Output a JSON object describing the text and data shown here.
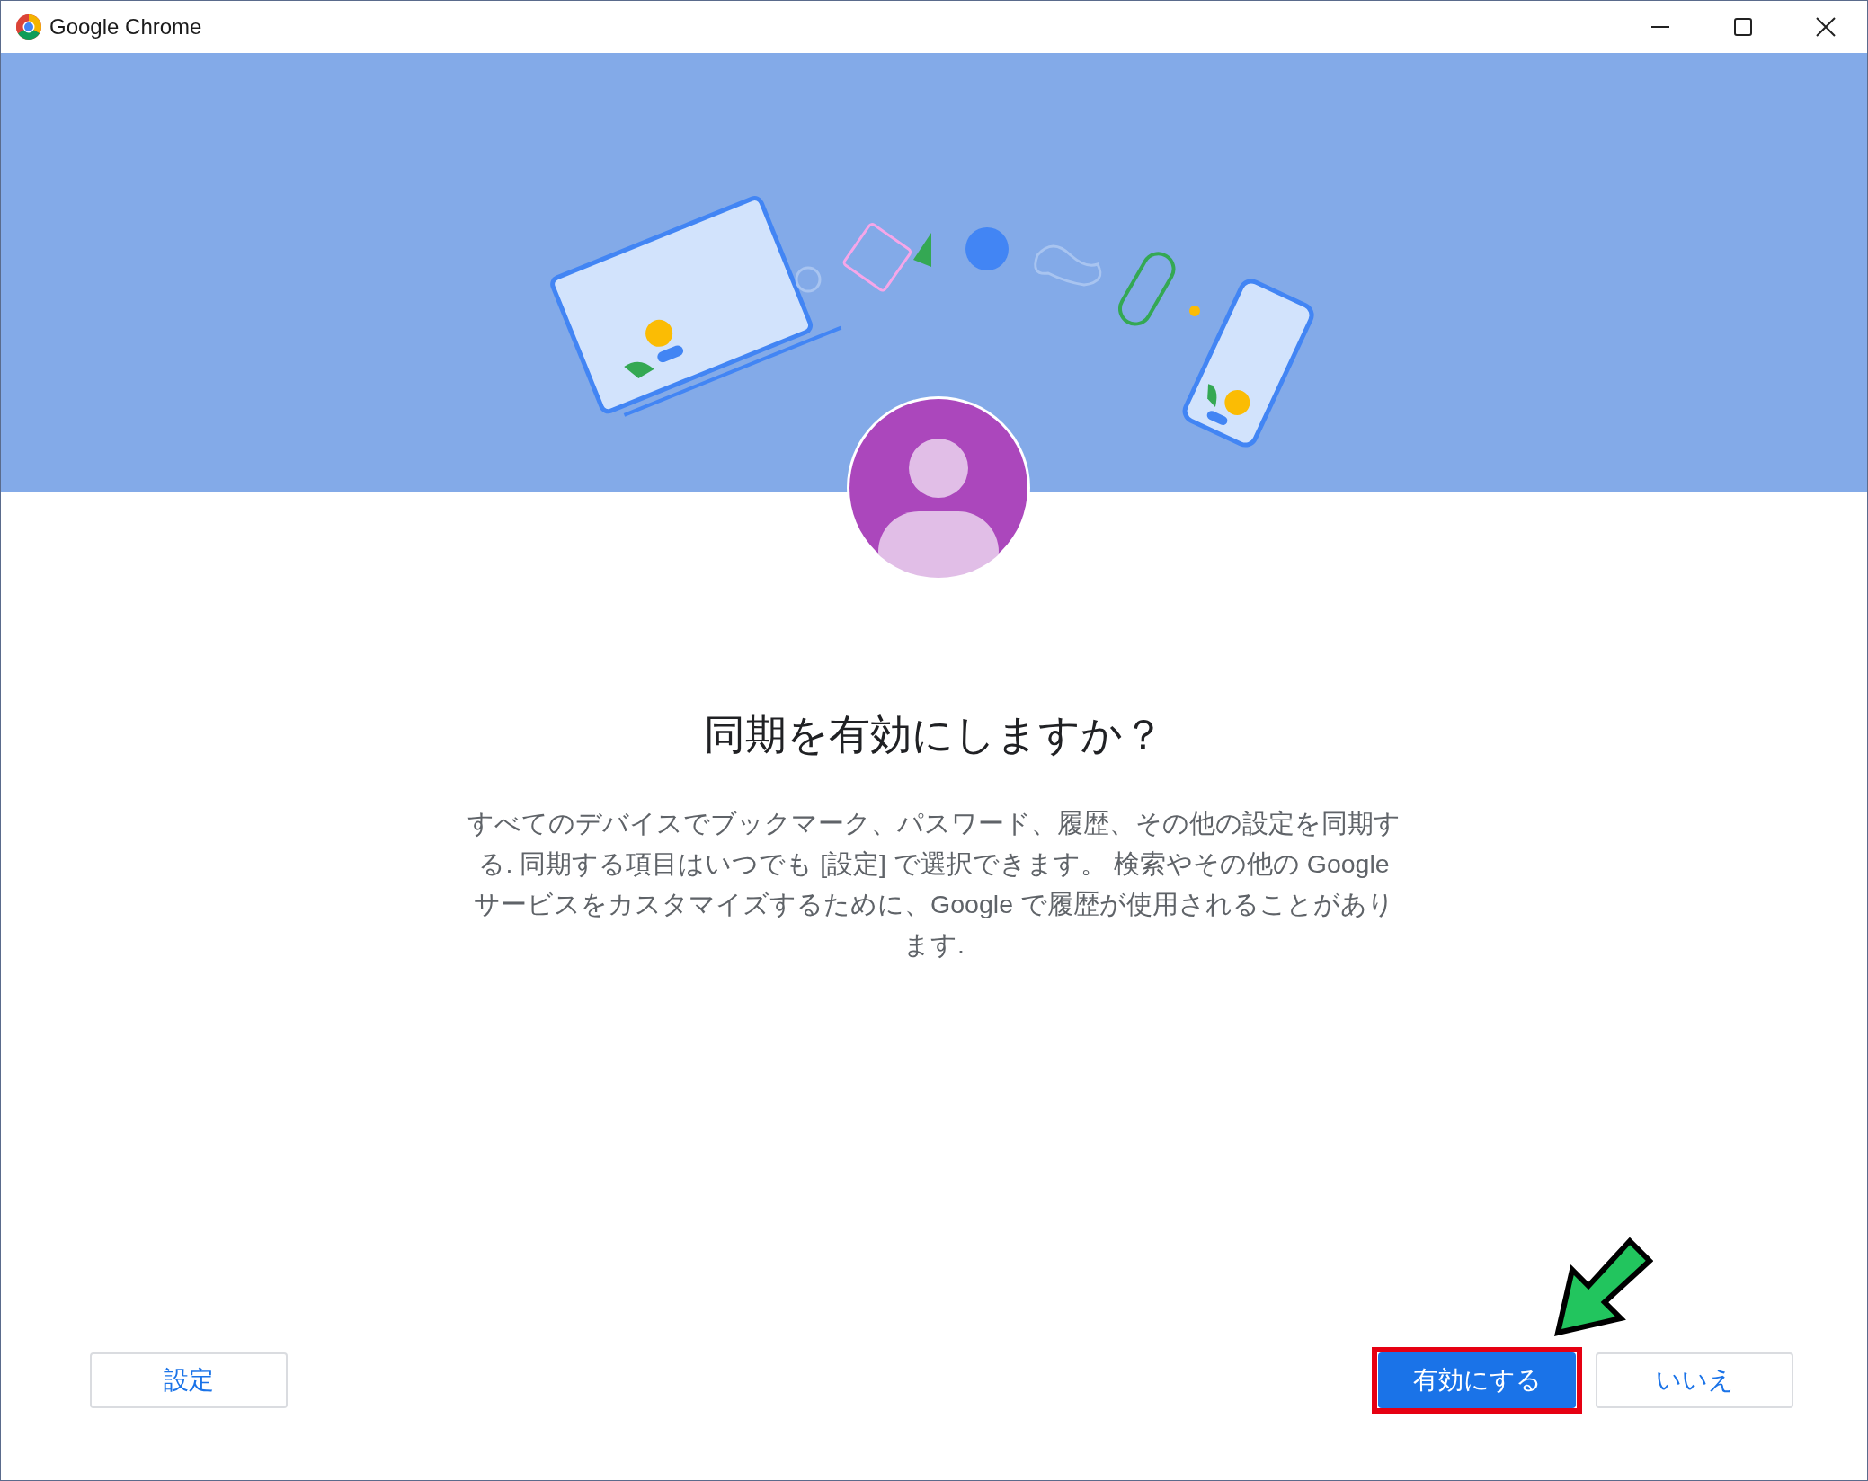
{
  "window": {
    "title": "Google Chrome"
  },
  "dialog": {
    "heading": "同期を有効にしますか？",
    "description": "すべてのデバイスでブックマーク、パスワード、履歴、その他の設定を同期する. 同期する項目はいつでも [設定] で選択できます。 検索やその他の Google サービスをカスタマイズするために、Google で履歴が使用されることがあります."
  },
  "buttons": [
    {
      "label": "設定",
      "kind": "secondary",
      "highlighted": false
    },
    {
      "label": "有効にする",
      "kind": "primary",
      "highlighted": true
    },
    {
      "label": "いいえ",
      "kind": "secondary",
      "highlighted": false
    }
  ]
}
